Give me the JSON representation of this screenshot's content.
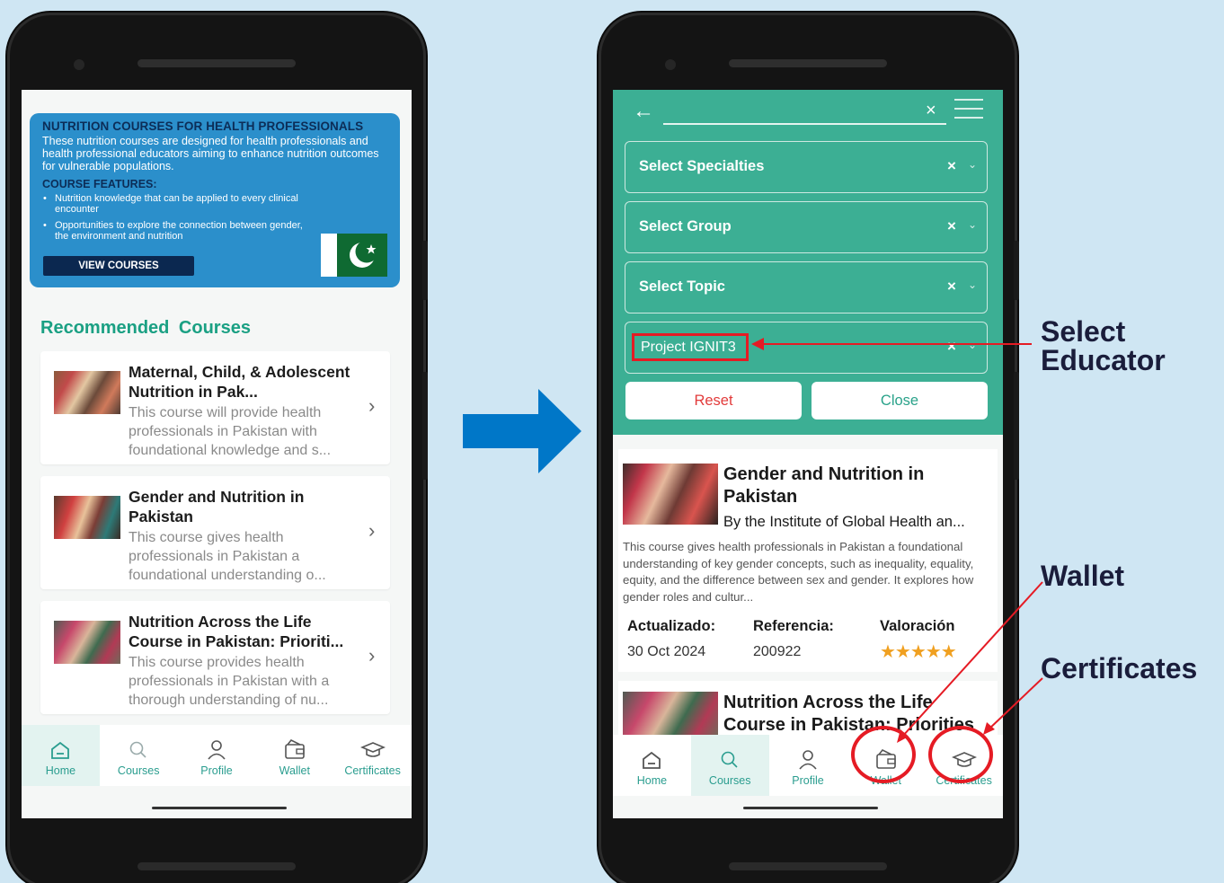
{
  "left_phone": {
    "banner": {
      "title": "NUTRITION COURSES FOR HEALTH PROFESSIONALS",
      "description": "These nutrition courses are designed for health professionals and health professional educators aiming to enhance nutrition outcomes for vulnerable populations.",
      "features_heading": "COURSE FEATURES:",
      "features": [
        "Nutrition knowledge that can be applied to every clinical encounter",
        "Opportunities to explore the connection between gender, the environment and nutrition"
      ],
      "button": "VIEW COURSES"
    },
    "recommended_title": "Recommended Courses",
    "courses": [
      {
        "title": "Maternal, Child, & Adolescent Nutrition in Pak...",
        "desc": "This course will provide health professionals in Pakistan with foundational knowledge and s..."
      },
      {
        "title": "Gender and Nutrition in Pakistan",
        "desc": "This course gives health professionals in Pakistan a foundational understanding o..."
      },
      {
        "title": "Nutrition Across the Life Course in Pakistan: Prioriti...",
        "desc": "This course provides health professionals in Pakistan with a thorough understanding of nu..."
      }
    ],
    "tabs": [
      {
        "label": "Home",
        "icon": "home-icon"
      },
      {
        "label": "Courses",
        "icon": "search-icon"
      },
      {
        "label": "Profile",
        "icon": "user-icon"
      },
      {
        "label": "Wallet",
        "icon": "wallet-icon"
      },
      {
        "label": "Certificates",
        "icon": "graduation-cap-icon"
      }
    ]
  },
  "right_phone": {
    "filters": [
      {
        "label": "Select Specialties"
      },
      {
        "label": "Select Group"
      },
      {
        "label": "Select Topic"
      },
      {
        "label": "Project IGNIT3"
      }
    ],
    "reset_label": "Reset",
    "close_label": "Close",
    "card1": {
      "title": "Gender and Nutrition in Pakistan",
      "by": "By the Institute of Global Health an...",
      "desc": "This course gives health professionals in Pakistan a foundational understanding of key gender concepts, such as inequality, equality, equity, and the difference between sex and gender. It explores how gender roles and cultur...",
      "updated_label": "Actualizado:",
      "updated_value": "30 Oct 2024",
      "ref_label": "Referencia:",
      "ref_value": "200922",
      "rating_label": "Valoración",
      "rating": 5,
      "stars": "★★★★★"
    },
    "card2": {
      "title": "Nutrition Across the Life Course in Pakistan: Priorities"
    },
    "tabs": [
      {
        "label": "Home",
        "icon": "home-icon"
      },
      {
        "label": "Courses",
        "icon": "search-icon"
      },
      {
        "label": "Profile",
        "icon": "user-icon"
      },
      {
        "label": "Wallet",
        "icon": "wallet-icon"
      },
      {
        "label": "Certificates",
        "icon": "graduation-cap-icon"
      }
    ]
  },
  "annotations": {
    "select_educator": "Select Educator",
    "wallet": "Wallet",
    "certificates": "Certificates"
  },
  "colors": {
    "teal": "#3caf94",
    "banner_blue": "#2b8fcb",
    "accent_red": "#e51b24",
    "arrow_blue": "#0077c8"
  }
}
